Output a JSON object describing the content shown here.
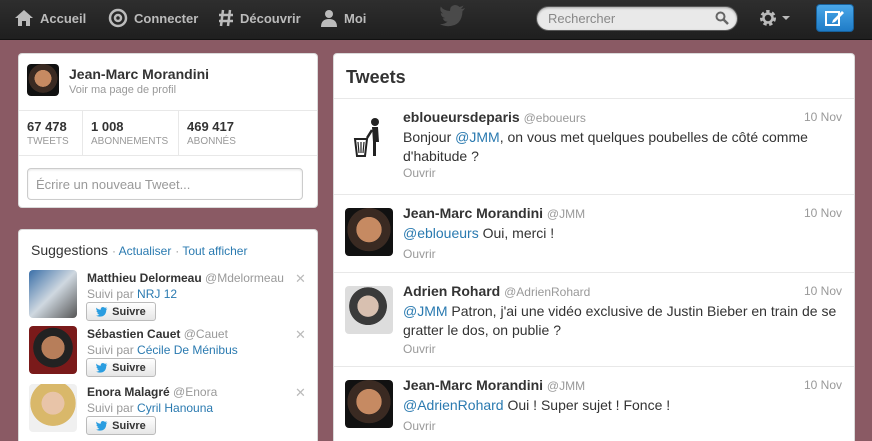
{
  "nav": {
    "home": "Accueil",
    "connect": "Connecter",
    "discover": "Découvrir",
    "me": "Moi"
  },
  "search": {
    "placeholder": "Rechercher"
  },
  "profile": {
    "name": "Jean-Marc Morandini",
    "link": "Voir ma page de profil",
    "stats": [
      {
        "value": "67 478",
        "label": "TWEETS"
      },
      {
        "value": "1 008",
        "label": "ABONNEMENTS"
      },
      {
        "value": "469 417",
        "label": "ABONNÉS"
      }
    ],
    "compose_placeholder": "Écrire un nouveau Tweet..."
  },
  "suggestions": {
    "title": "Suggestions",
    "refresh": "Actualiser",
    "view_all": "Tout afficher",
    "follow_label": "Suivre",
    "followed_by": "Suivi par",
    "items": [
      {
        "name": "Matthieu Delormeau",
        "handle": "@Mdelormeau",
        "via": "NRJ 12"
      },
      {
        "name": "Sébastien Cauet",
        "handle": "@Cauet",
        "via": "Cécile De Ménibus"
      },
      {
        "name": "Enora Malagré",
        "handle": "@Enora",
        "via": "Cyril Hanouna"
      }
    ]
  },
  "tweets": {
    "title": "Tweets",
    "open_label": "Ouvrir",
    "items": [
      {
        "author": "ebloueursdeparis",
        "handle": "@eboueurs",
        "time": "10 Nov",
        "mention": "",
        "pre": "Bonjour ",
        "mention_mid": "@JMM",
        "post": ", on vous met quelques poubelles de côté comme d'habitude ?"
      },
      {
        "author": "Jean-Marc Morandini",
        "handle": "@JMM",
        "time": "10 Nov",
        "mention": "@ebloueurs",
        "text": " Oui, merci !"
      },
      {
        "author": "Adrien Rohard",
        "handle": "@AdrienRohard",
        "time": "10 Nov",
        "mention": "@JMM",
        "text": " Patron, j'ai une vidéo exclusive de Justin Bieber en train de se gratter le dos, on publie ?"
      },
      {
        "author": "Jean-Marc Morandini",
        "handle": "@JMM",
        "time": "10 Nov",
        "mention": "@AdrienRohard",
        "text": " Oui ! Super sujet ! Fonce !"
      }
    ]
  },
  "colors": {
    "background": "#8a5a64",
    "link": "#2a7ab0",
    "compose_button": "#2f8fd8"
  },
  "icons": [
    "home-icon",
    "at-icon",
    "hash-icon",
    "person-icon",
    "twitter-bird-icon",
    "search-icon",
    "gear-icon",
    "compose-icon",
    "close-icon",
    "trash-icon"
  ]
}
